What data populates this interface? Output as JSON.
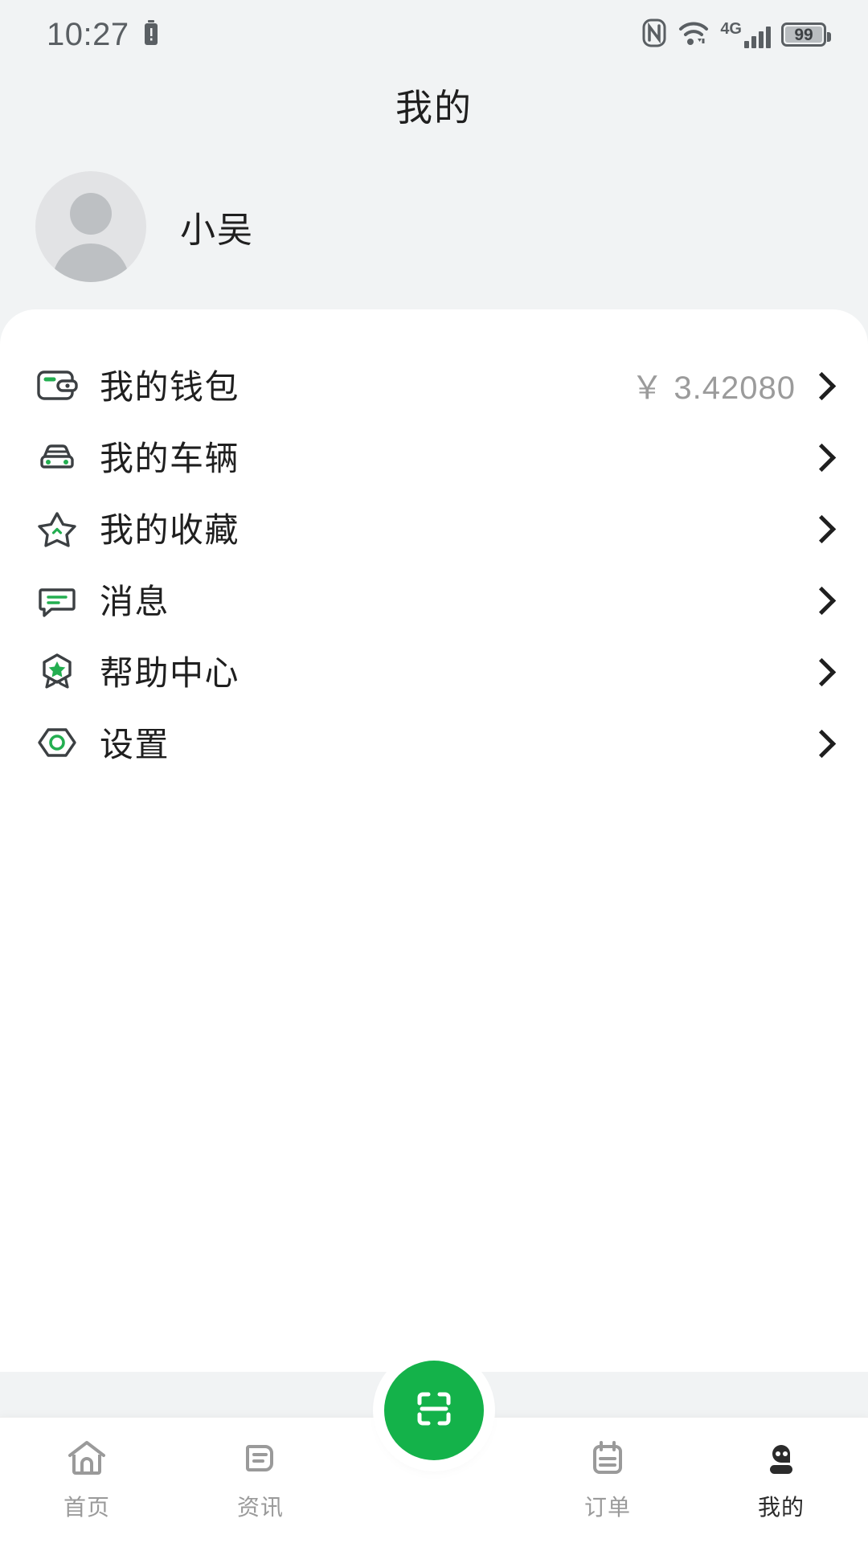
{
  "status_bar": {
    "time": "10:27",
    "battery_alert_icon": "battery-alert-icon",
    "nfc_icon": "nfc-icon",
    "wifi_icon": "wifi-icon",
    "network_label": "4G",
    "signal_icon": "signal-bars-icon",
    "battery_percent": "99"
  },
  "header": {
    "title": "我的"
  },
  "profile": {
    "avatar_icon": "avatar-placeholder-icon",
    "username": "小吴"
  },
  "menu": {
    "items": [
      {
        "icon": "wallet-icon",
        "label": "我的钱包",
        "value": "￥ 3.42080",
        "chevron": "chevron-right-icon"
      },
      {
        "icon": "car-icon",
        "label": "我的车辆",
        "value": "",
        "chevron": "chevron-right-icon"
      },
      {
        "icon": "star-icon",
        "label": "我的收藏",
        "value": "",
        "chevron": "chevron-right-icon"
      },
      {
        "icon": "message-icon",
        "label": "消息",
        "value": "",
        "chevron": "chevron-right-icon"
      },
      {
        "icon": "help-badge-icon",
        "label": "帮助中心",
        "value": "",
        "chevron": "chevron-right-icon"
      },
      {
        "icon": "settings-hex-icon",
        "label": "设置",
        "value": "",
        "chevron": "chevron-right-icon"
      }
    ]
  },
  "tabbar": {
    "items": [
      {
        "icon": "home-icon",
        "label": "首页",
        "active": false
      },
      {
        "icon": "news-icon",
        "label": "资讯",
        "active": false
      },
      {
        "icon": "orders-icon",
        "label": "订单",
        "active": false
      },
      {
        "icon": "profile-icon",
        "label": "我的",
        "active": true
      }
    ],
    "scan_button": {
      "icon": "scan-qr-icon"
    }
  },
  "colors": {
    "accent_green": "#14b24a",
    "icon_green": "#23ae50",
    "icon_dark": "#3c4043",
    "page_bg": "#f1f3f4",
    "card_bg": "#ffffff",
    "text_primary": "#1f1f1f",
    "text_muted": "#9b9b9b"
  }
}
